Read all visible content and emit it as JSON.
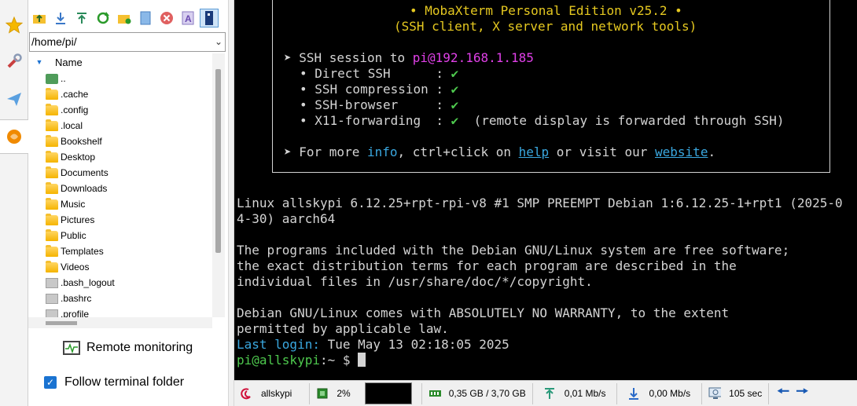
{
  "sftp": {
    "path": "/home/pi/",
    "column_header": "Name",
    "entries": [
      {
        "name": "..",
        "type": "updir"
      },
      {
        "name": ".cache",
        "type": "folder"
      },
      {
        "name": ".config",
        "type": "folder"
      },
      {
        "name": ".local",
        "type": "folder"
      },
      {
        "name": "Bookshelf",
        "type": "folder"
      },
      {
        "name": "Desktop",
        "type": "folder"
      },
      {
        "name": "Documents",
        "type": "folder"
      },
      {
        "name": "Downloads",
        "type": "folder"
      },
      {
        "name": "Music",
        "type": "folder"
      },
      {
        "name": "Pictures",
        "type": "folder"
      },
      {
        "name": "Public",
        "type": "folder"
      },
      {
        "name": "Templates",
        "type": "folder"
      },
      {
        "name": "Videos",
        "type": "folder"
      },
      {
        "name": ".bash_logout",
        "type": "file"
      },
      {
        "name": ".bashrc",
        "type": "file"
      },
      {
        "name": ".profile",
        "type": "file"
      }
    ],
    "remote_monitoring_label": "Remote monitoring",
    "follow_terminal_label": "Follow terminal folder",
    "follow_terminal_checked": true
  },
  "terminal": {
    "banner_title": "• MobaXterm Personal Edition v25.2 •",
    "banner_subtitle": "(SSH client, X server and network tools)",
    "session_prefix": "➤ SSH session to ",
    "session_host": "pi@192.168.1.185",
    "features": [
      {
        "label": "• Direct SSH      :",
        "check": "✔",
        "note": ""
      },
      {
        "label": "• SSH compression :",
        "check": "✔",
        "note": ""
      },
      {
        "label": "• SSH-browser     :",
        "check": "✔",
        "note": ""
      },
      {
        "label": "• X11-forwarding  :",
        "check": "✔",
        "note": "  (remote display is forwarded through SSH)"
      }
    ],
    "more_prefix": "➤ For more ",
    "more_info": "info",
    "more_mid": ", ctrl+click on ",
    "more_help": "help",
    "more_mid2": " or visit our ",
    "more_website": "website",
    "more_end": ".",
    "lines": [
      "Linux allskypi 6.12.25+rpt-rpi-v8 #1 SMP PREEMPT Debian 1:6.12.25-1+rpt1 (2025-0",
      "4-30) aarch64",
      "",
      "The programs included with the Debian GNU/Linux system are free software;",
      "the exact distribution terms for each program are described in the",
      "individual files in /usr/share/doc/*/copyright.",
      "",
      "Debian GNU/Linux comes with ABSOLUTELY NO WARRANTY, to the extent",
      "permitted by applicable law."
    ],
    "last_login_label": "Last login:",
    "last_login_value": " Tue May 13 02:18:05 2025",
    "prompt_user": "pi@allskypi",
    "prompt_rest": ":~ $ "
  },
  "statusbar": {
    "host": "allskypi",
    "cpu": "2%",
    "memory": "0,35 GB / 3,70 GB",
    "upload": "0,01 Mb/s",
    "download": "0,00 Mb/s",
    "uptime": "105 sec"
  },
  "colors": {
    "accent": "#1a73d1",
    "terminal_bg": "#000000",
    "banner_yellow": "#e5c820",
    "check_green": "#4ec94e",
    "host_magenta": "#e040e8",
    "link_cyan": "#3aa8e0"
  },
  "icons": {
    "vtabs": [
      "star-icon",
      "tools-icon",
      "send-icon",
      "sftp-browser-icon"
    ],
    "toolbar": [
      "parent-folder-icon",
      "download-icon",
      "upload-icon",
      "refresh-icon",
      "new-folder-icon",
      "new-file-icon",
      "delete-icon",
      "rename-icon",
      "terminal-follow-icon"
    ]
  }
}
